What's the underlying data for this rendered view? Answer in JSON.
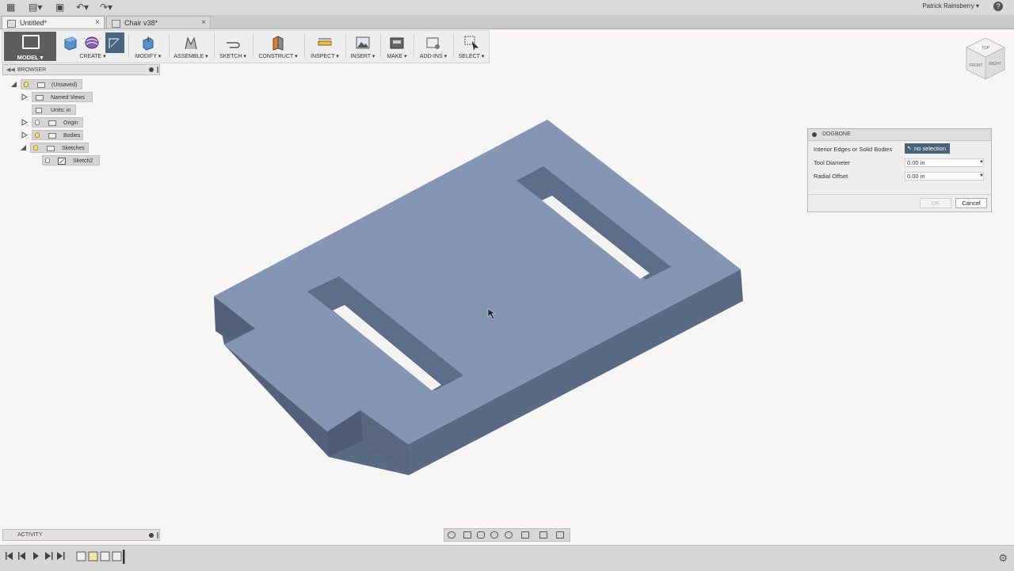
{
  "topbar": {
    "user_name": "Patrick Rainsberry ▾",
    "help": "?"
  },
  "tabs": [
    {
      "label": "Untitled*",
      "close": "×"
    },
    {
      "label": "Chair v38*",
      "close": "×"
    }
  ],
  "toolbar": {
    "workspace": "MODEL ▾",
    "groups": [
      "CREATE ▾",
      "MODIFY ▾",
      "ASSEMBLE ▾",
      "SKETCH ▾",
      "CONSTRUCT ▾",
      "INSPECT ▾",
      "INSERT ▾",
      "MAKE ▾",
      "ADD-INS ▾",
      "SELECT ▾"
    ]
  },
  "browser": {
    "title": "BROWSER",
    "items": [
      {
        "label": "(Unsaved)"
      },
      {
        "label": "Named Views"
      },
      {
        "label": "Units: in"
      },
      {
        "label": "Origin"
      },
      {
        "label": "Bodies"
      },
      {
        "label": "Sketches"
      },
      {
        "label": "Sketch2"
      }
    ]
  },
  "dialog": {
    "title": "DOGBONE",
    "fields": [
      {
        "label": "Interior Edges or Solid Bodies",
        "value": "no selection"
      },
      {
        "label": "Tool Diameter",
        "value": "0.00 in"
      },
      {
        "label": "Radial Offset",
        "value": "0.00 in"
      }
    ],
    "ok": "OK",
    "cancel": "Cancel"
  },
  "viewcube": {
    "top": "TOP",
    "front": "FRONT",
    "right": "RIGHT"
  },
  "activity": {
    "title": "ACTIVITY"
  },
  "colors": {
    "body_top": "#8596b5",
    "body_side": "#5b6a84",
    "body_side_dark": "#4e5c75",
    "slot_wall": "#5d6c88",
    "accent_toolbar": "#5e5e5e"
  }
}
